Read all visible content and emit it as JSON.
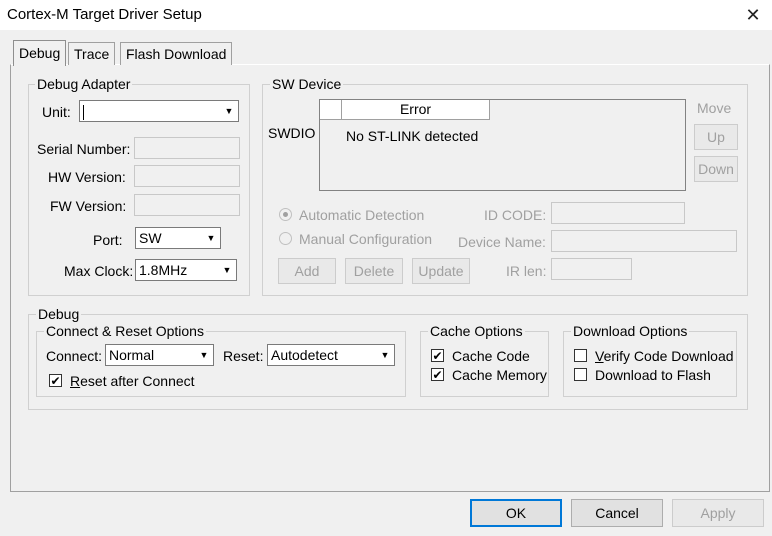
{
  "window": {
    "title": "Cortex-M Target Driver Setup"
  },
  "tabs": [
    {
      "label": "Debug",
      "active": true
    },
    {
      "label": "Trace",
      "active": false
    },
    {
      "label": "Flash Download",
      "active": false
    }
  ],
  "debug_adapter": {
    "title": "Debug Adapter",
    "unit_label": "Unit:",
    "unit_value": "",
    "serial_number_label": "Serial Number:",
    "serial_number_value": "",
    "hw_version_label": "HW Version:",
    "hw_version_value": "",
    "fw_version_label": "FW Version:",
    "fw_version_value": "",
    "port_label": "Port:",
    "port_value": "SW",
    "max_clock_label": "Max Clock:",
    "max_clock_value": "1.8MHz"
  },
  "sw_device": {
    "title": "SW Device",
    "swdio_label": "SWDIO",
    "column_header": "Error",
    "status_message": "No ST-LINK detected",
    "move_label": "Move",
    "up_button": "Up",
    "down_button": "Down",
    "automatic_detection": "Automatic Detection",
    "manual_configuration": "Manual Configuration",
    "id_code_label": "ID CODE:",
    "device_name_label": "Device Name:",
    "ir_len_label": "IR len:",
    "add_button": "Add",
    "delete_button": "Delete",
    "update_button": "Update"
  },
  "debug": {
    "title": "Debug",
    "connect_reset": {
      "title": "Connect & Reset Options",
      "connect_label": "Connect:",
      "connect_value": "Normal",
      "reset_label": "Reset:",
      "reset_value": "Autodetect",
      "reset_after_connect": "Reset after Connect",
      "reset_after_connect_checked": true
    },
    "cache_options": {
      "title": "Cache Options",
      "cache_code": "Cache Code",
      "cache_code_checked": true,
      "cache_memory": "Cache Memory",
      "cache_memory_checked": true
    },
    "download_options": {
      "title": "Download Options",
      "verify_code_download": "Verify Code Download",
      "verify_code_download_checked": false,
      "download_to_flash": "Download to Flash",
      "download_to_flash_checked": false
    }
  },
  "footer": {
    "ok": "OK",
    "cancel": "Cancel",
    "apply": "Apply"
  },
  "icons": {
    "close": "close-icon",
    "dropdown": "chevron-down-icon",
    "check": "check-icon"
  }
}
